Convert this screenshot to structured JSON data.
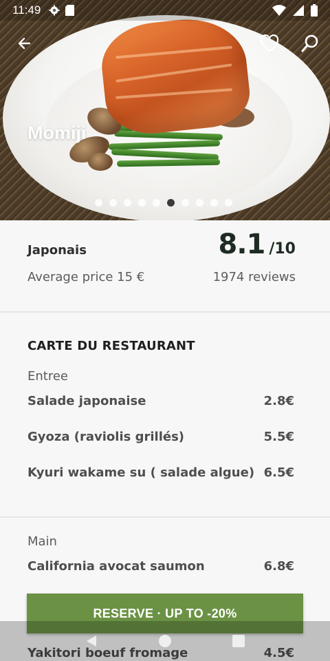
{
  "status_bar": {
    "time": "11:49",
    "icons": [
      "settings-icon",
      "sd-card-icon",
      "wifi-icon",
      "signal-icon",
      "battery-icon"
    ]
  },
  "header": {
    "restaurant_name": "Momiji",
    "back_icon": "arrow-left-icon",
    "favorite_icon": "heart-outline-icon",
    "search_icon": "search-icon"
  },
  "carousel": {
    "dot_count": 10,
    "active_index": 5
  },
  "info": {
    "cuisine": "Japonais",
    "rating_score": "8.1",
    "rating_max": "/10",
    "average_price": "Average price 15 €",
    "reviews": "1974 reviews"
  },
  "menu": {
    "title": "CARTE DU RESTAURANT",
    "sections": [
      {
        "category": "Entree",
        "items": [
          {
            "name": "Salade japonaise",
            "price": "2.8€"
          },
          {
            "name": "Gyoza (raviolis grillés)",
            "price": "5.5€"
          },
          {
            "name": "Kyuri wakame su ( salade algue)",
            "price": "6.5€"
          }
        ]
      },
      {
        "category": "Main",
        "items": [
          {
            "name": "California avocat saumon",
            "price": "6.8€"
          },
          {
            "name": "Yakitori boeuf fromage",
            "price": "4.5€"
          }
        ]
      }
    ]
  },
  "reserve_button": {
    "label": "RESERVE · UP TO -20%"
  },
  "nav_bar": {
    "items": [
      "back-triangle-icon",
      "home-circle-icon",
      "recents-square-icon"
    ]
  },
  "colors": {
    "accent_green": "#6b9244",
    "rating_text": "#1e2b22"
  }
}
